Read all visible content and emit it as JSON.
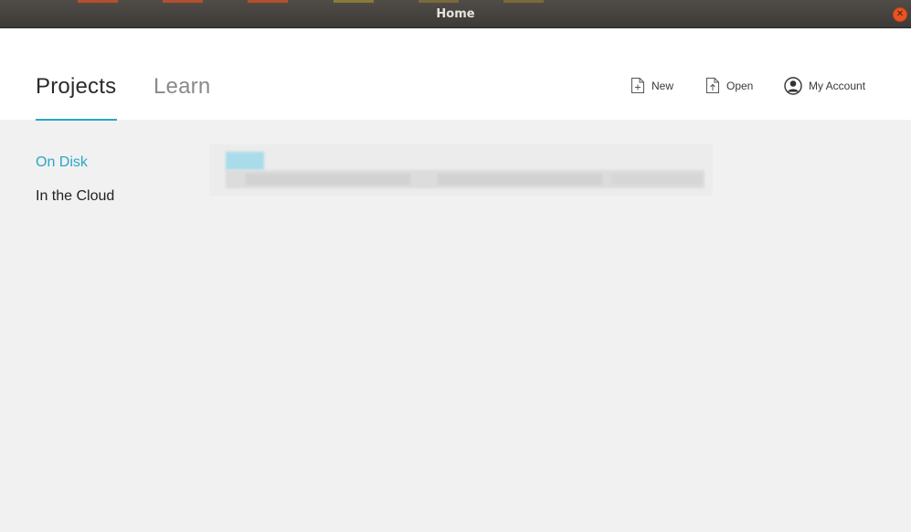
{
  "window": {
    "title": "Home"
  },
  "header": {
    "tabs": [
      {
        "label": "Projects",
        "active": true
      },
      {
        "label": "Learn",
        "active": false
      }
    ],
    "actions": {
      "new_label": "New",
      "open_label": "Open",
      "account_label": "My Account"
    }
  },
  "sidebar": {
    "items": [
      {
        "label": "On Disk",
        "active": true
      },
      {
        "label": "In the Cloud",
        "active": false
      }
    ]
  },
  "colors": {
    "accent": "#2aa7c4",
    "titlebar": "#3c3a37",
    "close_button": "#e95420",
    "content_background": "#f1f1f1"
  },
  "icons": [
    "close-icon",
    "new-file-icon",
    "open-file-icon",
    "account-icon"
  ]
}
